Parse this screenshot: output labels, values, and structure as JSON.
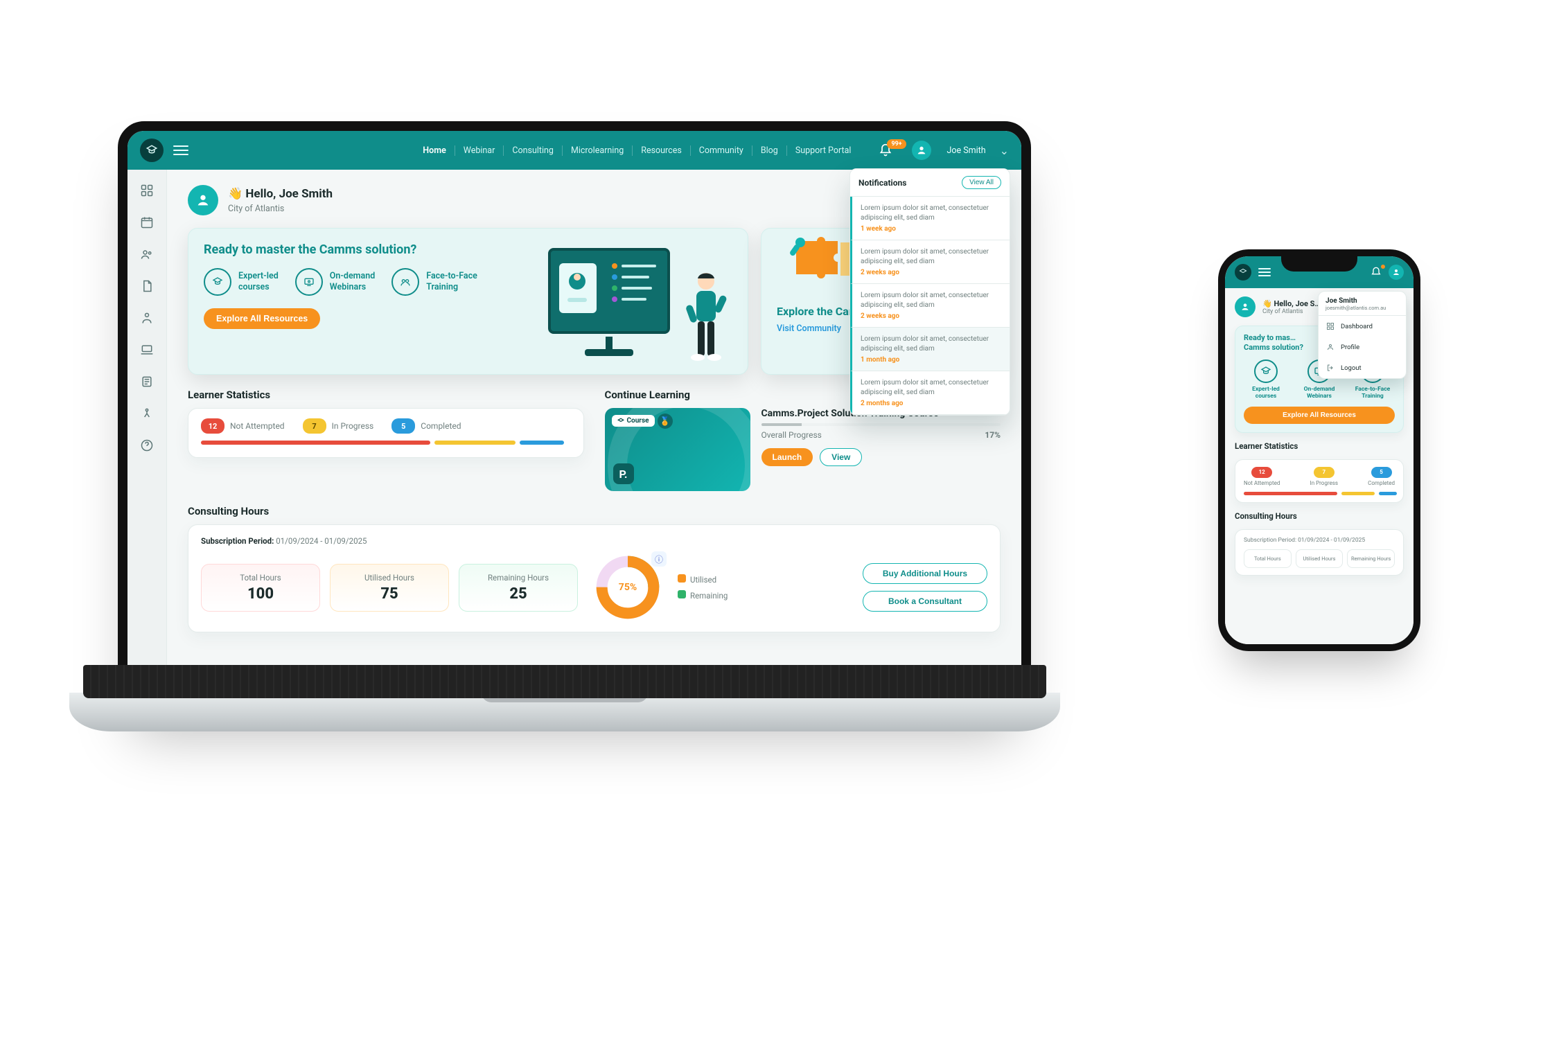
{
  "topnav": [
    "Home",
    "Webinar",
    "Consulting",
    "Microlearning",
    "Resources",
    "Community",
    "Blog",
    "Support Portal"
  ],
  "topnav_active": 0,
  "notifications_badge": "99+",
  "user": {
    "name": "Joe Smith",
    "chev": "⌄"
  },
  "greeting": {
    "wave": "👋",
    "hello": "Hello, Joe Smith",
    "org": "City of Atlantis"
  },
  "hero": {
    "title": "Ready to master the Camms solution?",
    "benefits": [
      {
        "label_top": "Expert-led",
        "label_bot": "courses"
      },
      {
        "label_top": "On-demand",
        "label_bot": "Webinars"
      },
      {
        "label_top": "Face-to-Face",
        "label_bot": "Training"
      }
    ],
    "cta": "Explore All Resources",
    "community_card": {
      "title": "Explore the Camms…",
      "link": "Visit Community"
    }
  },
  "stats": {
    "title": "Learner Statistics",
    "legend": [
      {
        "count": "12",
        "label": "Not Attempted",
        "color": "red",
        "pct": 62
      },
      {
        "count": "7",
        "label": "In Progress",
        "color": "yellow",
        "pct": 22
      },
      {
        "count": "5",
        "label": "Completed",
        "color": "blue",
        "pct": 12
      }
    ]
  },
  "continue": {
    "title": "Continue Learning",
    "thumb_badge": "Course",
    "thumb_letter": "P.",
    "course": "Camms.Project Solution Training Course",
    "progress_label": "Overall Progress",
    "progress_value": "17%",
    "launch": "Launch",
    "view": "View"
  },
  "consulting": {
    "title": "Consulting Hours",
    "period_label": "Subscription Period:",
    "period_value": "01/09/2024 - 01/09/2025",
    "tiles": [
      {
        "label": "Total Hours",
        "value": "100"
      },
      {
        "label": "Utilised Hours",
        "value": "75"
      },
      {
        "label": "Remaining Hours",
        "value": "25"
      }
    ],
    "donut_percent": "75%",
    "donut_pct_num": 75,
    "legend": [
      {
        "label": "Utilised",
        "color": "#f7921e"
      },
      {
        "label": "Remaining",
        "color": "#2fb36a"
      }
    ],
    "actions": [
      "Buy Additional Hours",
      "Book a Consultant"
    ]
  },
  "notifications": {
    "title": "Notifications",
    "view_all": "View All",
    "items": [
      {
        "text": "Lorem ipsum dolor sit amet, consectetuer adipiscing elit, sed diam",
        "time": "1 week ago",
        "hl": false
      },
      {
        "text": "Lorem ipsum dolor sit amet, consectetuer adipiscing elit, sed diam",
        "time": "2 weeks ago",
        "hl": false
      },
      {
        "text": "Lorem ipsum dolor sit amet, consectetuer adipiscing elit, sed diam",
        "time": "2 weeks ago",
        "hl": false
      },
      {
        "text": "Lorem ipsum dolor sit amet, consectetuer adipiscing elit, sed diam",
        "time": "1 month ago",
        "hl": true
      },
      {
        "text": "Lorem ipsum dolor sit amet, consectetuer adipiscing elit, sed diam",
        "time": "2 months ago",
        "hl": false
      }
    ]
  },
  "phone": {
    "greeting": {
      "hello": "Hello, Joe S…",
      "org": "City of Atlantis"
    },
    "hero_title_a": "Ready to mas…",
    "hero_title_b": "Camms solution?",
    "benefits": [
      {
        "label": "Expert-led courses"
      },
      {
        "label": "On-demand Webinars"
      },
      {
        "label": "Face-to-Face Training"
      }
    ],
    "cta": "Explore All Resources",
    "stats_title": "Learner Statistics",
    "consult_title": "Consulting Hours",
    "period": "Subscription Period: 01/09/2024 - 01/09/2025",
    "tiles": [
      "Total Hours",
      "Utilised Hours",
      "Remaining Hours"
    ],
    "user_menu": {
      "name": "Joe Smith",
      "email": "joesmith@atlantis.com.au",
      "items": [
        "Dashboard",
        "Profile",
        "Logout"
      ]
    }
  }
}
